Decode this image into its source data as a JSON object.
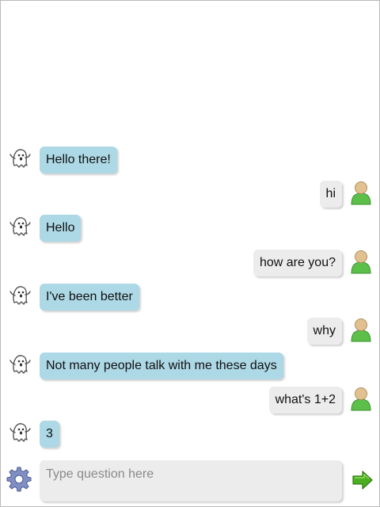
{
  "colors": {
    "bot_bubble": "#add8e6",
    "user_bubble": "#ececec",
    "send_arrow": "#4caf1f",
    "user_avatar_body": "#5cbf4a",
    "user_avatar_head": "#e2c190"
  },
  "icons": {
    "bot_avatar": "ghost-icon",
    "user_avatar": "person-icon",
    "settings": "gear-icon",
    "send": "right-arrow-icon"
  },
  "messages": [
    {
      "sender": "bot",
      "text": "Hello there!"
    },
    {
      "sender": "user",
      "text": "hi"
    },
    {
      "sender": "bot",
      "text": "Hello"
    },
    {
      "sender": "user",
      "text": "how are you?"
    },
    {
      "sender": "bot",
      "text": "I've been better"
    },
    {
      "sender": "user",
      "text": "why"
    },
    {
      "sender": "bot",
      "text": "Not many people talk with me these days"
    },
    {
      "sender": "user",
      "text": "what's 1+2"
    },
    {
      "sender": "bot",
      "text": "3"
    }
  ],
  "composer": {
    "value": "",
    "placeholder": "Type question here"
  }
}
